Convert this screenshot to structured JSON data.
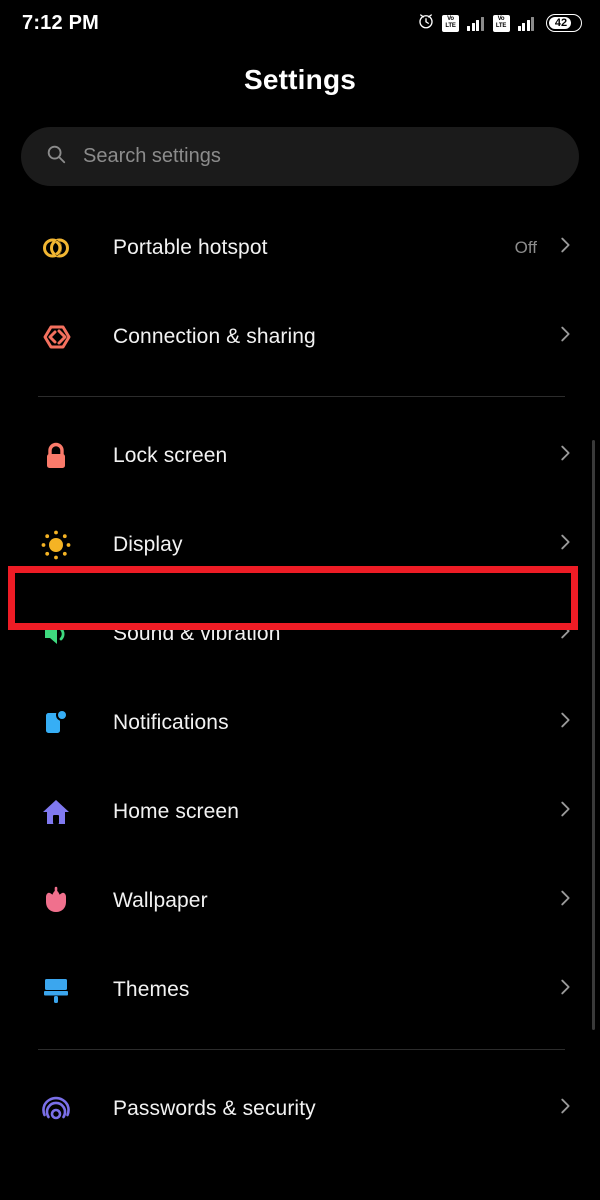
{
  "status_bar": {
    "time": "7:12 PM",
    "alarm_icon": "alarm-clock-icon",
    "sim1_volte_line1": "Vo",
    "sim1_volte_line2": "LTE",
    "sim2_volte_line1": "Vo",
    "sim2_volte_line2": "LTE",
    "battery_level": "42"
  },
  "header": {
    "title": "Settings"
  },
  "search": {
    "placeholder": "Search settings",
    "value": "",
    "icon": "search-icon"
  },
  "groups": [
    {
      "id": "connectivity",
      "rows": [
        {
          "id": "portable-hotspot",
          "label": "Portable hotspot",
          "value": "Off",
          "icon": "hotspot-icon",
          "color": "#F2B632"
        },
        {
          "id": "connection-sharing",
          "label": "Connection & sharing",
          "value": "",
          "icon": "connection-sharing-icon",
          "color": "#F4705E"
        }
      ]
    },
    {
      "id": "personalization",
      "rows": [
        {
          "id": "lock-screen",
          "label": "Lock screen",
          "value": "",
          "icon": "lock-icon",
          "color": "#FA7A6A"
        },
        {
          "id": "display",
          "label": "Display",
          "value": "",
          "icon": "brightness-sun-icon",
          "color": "#F5B324"
        },
        {
          "id": "sound-vibration",
          "label": "Sound & vibration",
          "value": "",
          "icon": "speaker-icon",
          "color": "#3ED97E"
        },
        {
          "id": "notifications",
          "label": "Notifications",
          "value": "",
          "icon": "notification-badge-icon",
          "color": "#36AEF5"
        },
        {
          "id": "home-screen",
          "label": "Home screen",
          "value": "",
          "icon": "house-icon",
          "color": "#8079F0"
        },
        {
          "id": "wallpaper",
          "label": "Wallpaper",
          "value": "",
          "icon": "tulip-flower-icon",
          "color": "#F0708D"
        },
        {
          "id": "themes",
          "label": "Themes",
          "value": "",
          "icon": "paintbrush-icon",
          "color": "#3BA6EE"
        }
      ]
    },
    {
      "id": "privacy",
      "rows": [
        {
          "id": "passwords-security",
          "label": "Passwords & security",
          "value": "",
          "icon": "fingerprint-icon",
          "color": "#7A6FE8"
        }
      ]
    }
  ],
  "annotation": {
    "highlight_target": "display",
    "highlight_color": "#ee1c25"
  }
}
